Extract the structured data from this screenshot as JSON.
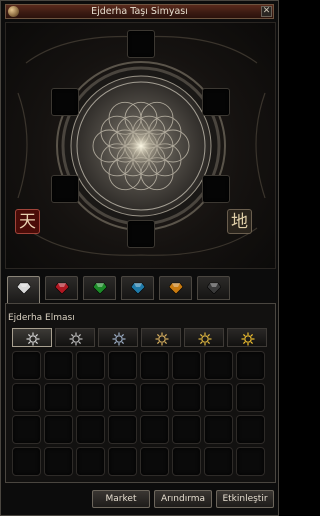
{
  "window": {
    "title": "Ejderha Taşı Simyası"
  },
  "seals": {
    "heaven": "天",
    "earth": "地"
  },
  "gem_tabs": [
    {
      "name": "white",
      "color": "#d8d8d8",
      "active": true
    },
    {
      "name": "red",
      "color": "#b01822"
    },
    {
      "name": "green",
      "color": "#1c8a28"
    },
    {
      "name": "blue",
      "color": "#1f7aa8"
    },
    {
      "name": "orange",
      "color": "#c87a10"
    },
    {
      "name": "dark",
      "color": "#3a3a3a"
    }
  ],
  "inventory": {
    "label": "Ejderha Elması",
    "sub_tab_icons": [
      {
        "color": "#d8d8d8",
        "active": true
      },
      {
        "color": "#bfbfbf"
      },
      {
        "color": "#9fb0c8"
      },
      {
        "color": "#d8b060"
      },
      {
        "color": "#e0b840"
      },
      {
        "color": "#f0c030"
      }
    ]
  },
  "buttons": {
    "market": "Market",
    "refine": "Arındırma",
    "activate": "Etkinleştir"
  }
}
